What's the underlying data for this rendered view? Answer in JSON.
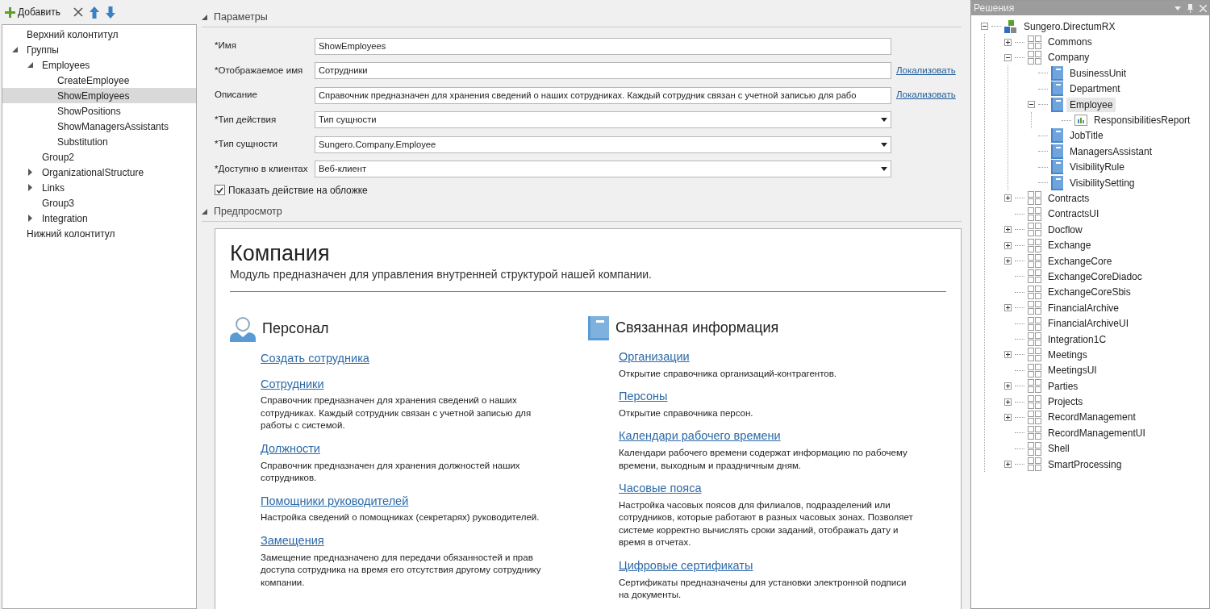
{
  "toolbar": {
    "add_label": "Добавить"
  },
  "outline": [
    {
      "label": "Верхний колонтитул",
      "selected": false
    },
    {
      "label": "Группы",
      "expanded": true,
      "selected": false,
      "children": [
        {
          "label": "Employees",
          "expanded": true,
          "selected": false,
          "children": [
            {
              "label": "CreateEmployee",
              "selected": false
            },
            {
              "label": "ShowEmployees",
              "selected": true
            },
            {
              "label": "ShowPositions",
              "selected": false
            },
            {
              "label": "ShowManagersAssistants",
              "selected": false
            },
            {
              "label": "Substitution",
              "selected": false
            }
          ]
        },
        {
          "label": "Group2",
          "selected": false
        },
        {
          "label": "OrganizationalStructure",
          "expanded": false,
          "selected": false
        },
        {
          "label": "Links",
          "expanded": false,
          "selected": false
        },
        {
          "label": "Group3",
          "selected": false
        },
        {
          "label": "Integration",
          "expanded": false,
          "selected": false
        }
      ]
    },
    {
      "label": "Нижний колонтитул",
      "selected": false
    }
  ],
  "parameters": {
    "title": "Параметры",
    "expanded": true,
    "fields": [
      {
        "label": "*Имя",
        "kind": "text",
        "value": "ShowEmployees"
      },
      {
        "label": "*Отображаемое имя",
        "kind": "text",
        "value": "Сотрудники",
        "link": "Локализовать"
      },
      {
        "label": "Описание",
        "kind": "text",
        "value": "Справочник предназначен для хранения сведений о наших сотрудниках. Каждый сотрудник связан с учетной записью для рабо",
        "link": "Локализовать"
      },
      {
        "label": "*Тип действия",
        "kind": "select",
        "value": "Тип сущности"
      },
      {
        "label": "*Тип сущности",
        "kind": "select",
        "value": "Sungero.Company.Employee"
      },
      {
        "label": "*Доступно в клиентах",
        "kind": "select",
        "value": "Веб-клиент"
      }
    ],
    "checkbox": {
      "label": "Показать действие на обложке",
      "checked": true
    }
  },
  "preview": {
    "title": "Предпросмотр",
    "expanded": true,
    "heading": "Компания",
    "subtitle": "Модуль предназначен для управления внутренней структурой нашей компании.",
    "sections": [
      {
        "title": "Персонал",
        "kind": "person",
        "links": [
          {
            "label": "Создать сотрудника"
          },
          {
            "label": "Сотрудники",
            "description": "Справочник предназначен для хранения сведений о наших сотрудниках. Каждый сотрудник связан с учетной записью для работы с системой."
          },
          {
            "label": "Должности",
            "description": "Справочник предназначен для хранения должностей наших сотрудников."
          },
          {
            "label": "Помощники руководителей",
            "description": "Настройка сведений о помощниках (секретарях) руководителей."
          },
          {
            "label": "Замещения",
            "description": "Замещение предназначено для передачи обязанностей и прав доступа сотрудника на время его отсутствия другому сотруднику компании."
          }
        ]
      },
      {
        "title": "Связанная информация",
        "kind": "book",
        "links": [
          {
            "label": "Организации",
            "description": "Открытие справочника организаций-контрагентов."
          },
          {
            "label": "Персоны",
            "description": "Открытие справочника персон."
          },
          {
            "label": "Календари рабочего времени",
            "description": "Календари рабочего времени содержат информацию по рабочему времени, выходным и праздничным дням."
          },
          {
            "label": "Часовые пояса",
            "description": "Настройка часовых поясов для филиалов, подразделений или сотрудников, которые работают в разных часовых зонах. Позволяет системе корректно вычислять сроки заданий, отображать дату и время в отчетах."
          },
          {
            "label": "Цифровые сертификаты",
            "description": "Сертификаты предназначены для установки электронной подписи на документы."
          }
        ]
      }
    ]
  },
  "solutions": {
    "title": "Решения",
    "tree": [
      {
        "label": "Sungero.DirectumRX",
        "kind": "solution",
        "expanded": true,
        "selected": false,
        "children": [
          {
            "label": "Commons",
            "kind": "module",
            "expanded": false,
            "selected": false
          },
          {
            "label": "Company",
            "kind": "module",
            "expanded": true,
            "selected": false,
            "children": [
              {
                "label": "BusinessUnit",
                "kind": "entity",
                "selected": false
              },
              {
                "label": "Department",
                "kind": "entity",
                "selected": false
              },
              {
                "label": "Employee",
                "kind": "entity",
                "expanded": true,
                "selected": true,
                "children": [
                  {
                    "label": "ResponsibilitiesReport",
                    "kind": "report",
                    "selected": false
                  }
                ]
              },
              {
                "label": "JobTitle",
                "kind": "entity",
                "selected": false
              },
              {
                "label": "ManagersAssistant",
                "kind": "entity",
                "selected": false
              },
              {
                "label": "VisibilityRule",
                "kind": "entity",
                "selected": false
              },
              {
                "label": "VisibilitySetting",
                "kind": "entity",
                "selected": false
              }
            ]
          },
          {
            "label": "Contracts",
            "kind": "module",
            "expanded": false,
            "selected": false
          },
          {
            "label": "ContractsUI",
            "kind": "module",
            "selected": false
          },
          {
            "label": "Docflow",
            "kind": "module",
            "expanded": false,
            "selected": false
          },
          {
            "label": "Exchange",
            "kind": "module",
            "expanded": false,
            "selected": false
          },
          {
            "label": "ExchangeCore",
            "kind": "module",
            "expanded": false,
            "selected": false
          },
          {
            "label": "ExchangeCoreDiadoc",
            "kind": "module",
            "selected": false
          },
          {
            "label": "ExchangeCoreSbis",
            "kind": "module",
            "selected": false
          },
          {
            "label": "FinancialArchive",
            "kind": "module",
            "expanded": false,
            "selected": false
          },
          {
            "label": "FinancialArchiveUI",
            "kind": "module",
            "selected": false
          },
          {
            "label": "Integration1C",
            "kind": "module",
            "selected": false
          },
          {
            "label": "Meetings",
            "kind": "module",
            "expanded": false,
            "selected": false
          },
          {
            "label": "MeetingsUI",
            "kind": "module",
            "selected": false
          },
          {
            "label": "Parties",
            "kind": "module",
            "expanded": false,
            "selected": false
          },
          {
            "label": "Projects",
            "kind": "module",
            "expanded": false,
            "selected": false
          },
          {
            "label": "RecordManagement",
            "kind": "module",
            "expanded": false,
            "selected": false
          },
          {
            "label": "RecordManagementUI",
            "kind": "module",
            "selected": false
          },
          {
            "label": "Shell",
            "kind": "module",
            "selected": false
          },
          {
            "label": "SmartProcessing",
            "kind": "module",
            "expanded": false,
            "selected": false
          }
        ]
      }
    ]
  }
}
